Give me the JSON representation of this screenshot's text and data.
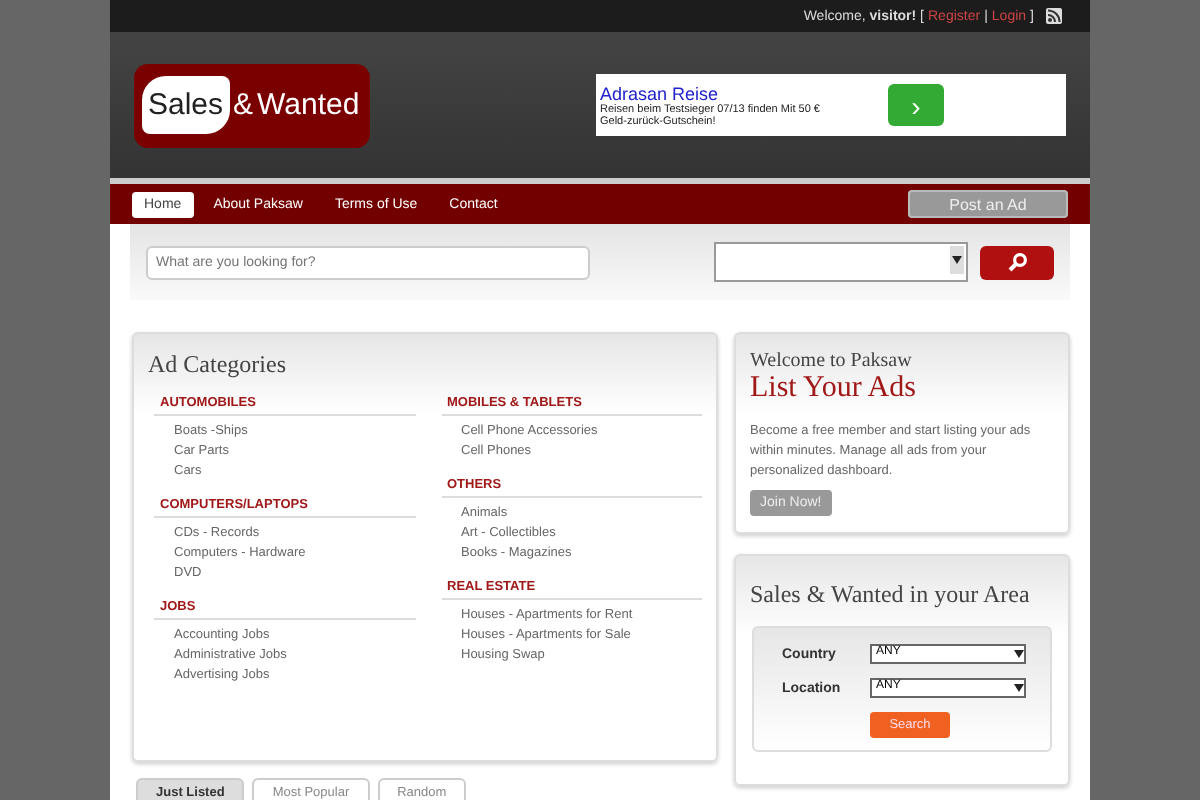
{
  "topbar": {
    "welcome": "Welcome, **visitor!** [",
    "register": "Register",
    "sep": "|",
    "login": "Login",
    "close": "]"
  },
  "logo": {
    "part_1": "Sales",
    "part_2": "&",
    "part_3": "Wanted"
  },
  "ad": {
    "title": "Adrasan Reise",
    "text": "Reisen beim Testsieger 07/13 finden Mit 50 € Geld-zurück-Gutschein!",
    "arrow": "›"
  },
  "nav": {
    "items": [
      {
        "label": "Home",
        "selected": true
      },
      {
        "label": "About Paksaw",
        "selected": false
      },
      {
        "label": "Terms of Use",
        "selected": false
      },
      {
        "label": "Contact",
        "selected": false
      }
    ],
    "post": "Post an Ad"
  },
  "search": {
    "placeholder": "What are you looking for?"
  },
  "categories": {
    "title": "Ad Categories",
    "columns": [
      [
        {
          "name": "AUTOMOBILES",
          "items": [
            "Boats -Ships",
            "Car Parts",
            "Cars"
          ]
        },
        {
          "name": "COMPUTERS/LAPTOPS",
          "items": [
            "CDs - Records",
            "Computers - Hardware",
            "DVD"
          ]
        },
        {
          "name": "JOBS",
          "items": [
            "Accounting Jobs",
            "Administrative Jobs",
            "Advertising Jobs"
          ]
        }
      ],
      [
        {
          "name": "MOBILES & TABLETS",
          "items": [
            "Cell Phone Accessories",
            "Cell Phones"
          ]
        },
        {
          "name": "OTHERS",
          "items": [
            "Animals",
            "Art - Collectibles",
            "Books - Magazines"
          ]
        },
        {
          "name": "REAL ESTATE",
          "items": [
            "Houses - Apartments for Rent",
            "Houses - Apartments for Sale",
            "Housing Swap"
          ]
        }
      ]
    ]
  },
  "welcome": {
    "title": "Welcome to Paksaw",
    "subtitle": "List Your Ads",
    "text": "Become a free member and start listing your ads within minutes. Manage all ads from your personalized dashboard.",
    "button": "Join Now!"
  },
  "area": {
    "title": "Sales & Wanted in your Area",
    "fields": [
      {
        "label": "Country",
        "value": "ANY"
      },
      {
        "label": "Location",
        "value": "ANY"
      }
    ],
    "button": "Search"
  },
  "tabs": [
    {
      "label": "Just Listed",
      "selected": true
    },
    {
      "label": "Most Popular",
      "selected": false
    },
    {
      "label": "Random",
      "selected": false
    }
  ]
}
